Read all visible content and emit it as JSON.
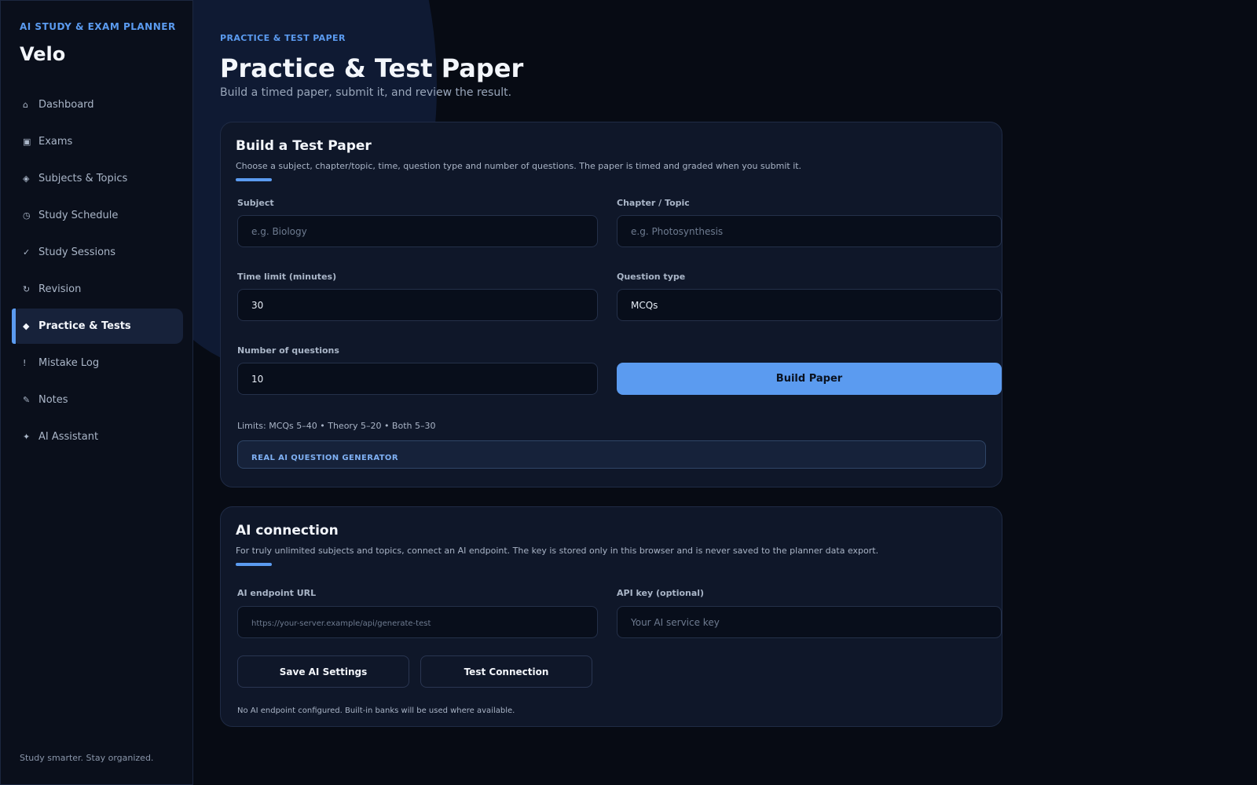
{
  "sidebar": {
    "eyebrow": "AI STUDY & EXAM PLANNER",
    "brand": "Velo",
    "items": [
      {
        "icon": "⌂",
        "label": "Dashboard",
        "active": false
      },
      {
        "icon": "▣",
        "label": "Exams",
        "active": false
      },
      {
        "icon": "◈",
        "label": "Subjects & Topics",
        "active": false
      },
      {
        "icon": "◷",
        "label": "Study Schedule",
        "active": false
      },
      {
        "icon": "✓",
        "label": "Study Sessions",
        "active": false
      },
      {
        "icon": "↻",
        "label": "Revision",
        "active": false
      },
      {
        "icon": "◆",
        "label": "Practice & Tests",
        "active": true
      },
      {
        "icon": "!",
        "label": "Mistake Log",
        "active": false
      },
      {
        "icon": "✎",
        "label": "Notes",
        "active": false
      },
      {
        "icon": "✦",
        "label": "AI Assistant",
        "active": false
      }
    ],
    "tagline": "Study smarter. Stay organized."
  },
  "header": {
    "eyebrow": "PRACTICE & TEST PAPER",
    "title": "Practice & Test Paper",
    "subtitle": "Build a timed paper, submit it, and review the result."
  },
  "build_card": {
    "title": "Build a Test Paper",
    "description": "Choose a subject, chapter/topic, time, question type and number of questions. The paper is timed and graded when you submit it.",
    "subject_label": "Subject",
    "subject_placeholder": "e.g. Biology",
    "subject_value": "",
    "topic_label": "Chapter / Topic",
    "topic_placeholder": "e.g. Photosynthesis",
    "topic_value": "",
    "time_label": "Time limit (minutes)",
    "time_value": "30",
    "type_label": "Question type",
    "type_value": "MCQs",
    "count_label": "Number of questions",
    "count_value": "10",
    "build_button": "Build Paper",
    "limits": "Limits: MCQs 5–40 • Theory 5–20 • Both 5–30",
    "ai_banner": "REAL AI QUESTION GENERATOR"
  },
  "ai_card": {
    "title": "AI connection",
    "description": "For truly unlimited subjects and topics, connect an AI endpoint. The key is stored only in this browser and is never saved to the planner data export.",
    "endpoint_label": "AI endpoint URL",
    "endpoint_placeholder": "https://your-server.example/api/generate-test",
    "key_label": "API key (optional)",
    "key_placeholder": "Your AI service key",
    "save_button": "Save AI Settings",
    "test_button": "Test Connection",
    "status": "No AI endpoint configured. Built-in banks will be used where available."
  },
  "colors": {
    "accent": "#5b9bf0",
    "background": "#070b14",
    "card": "#0f1729"
  }
}
